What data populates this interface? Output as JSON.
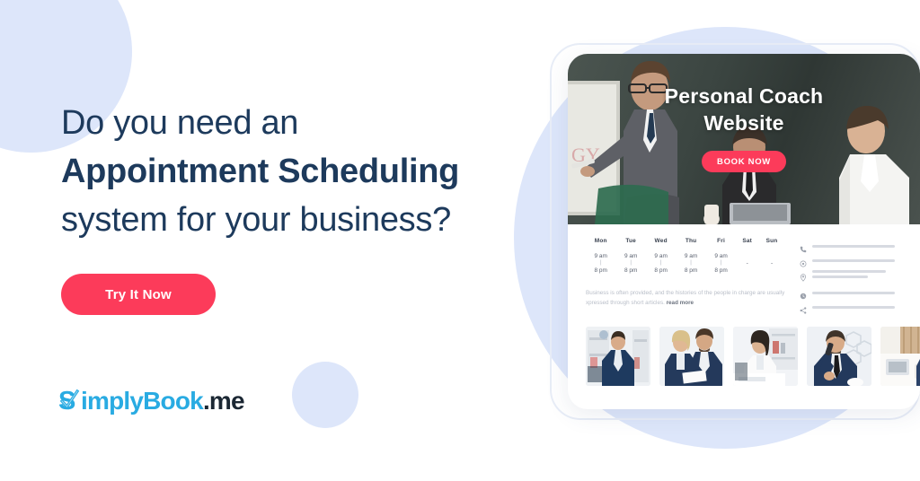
{
  "colors": {
    "headline": "#1d3a5c",
    "accent_pink": "#fc3b5a",
    "logo_blue": "#29ABE2",
    "logo_dark": "#1b2733",
    "blob_blue": "#dde6fa"
  },
  "hero": {
    "headline_line1": "Do you need an",
    "headline_line2": "Appointment Scheduling",
    "headline_line3": "system for your business?",
    "cta_label": "Try It Now"
  },
  "logo": {
    "name_part1": "S",
    "name_part2": "implyBook",
    "name_part3": ".me",
    "mark_icon": "checkmark-s-icon"
  },
  "mockup": {
    "hero": {
      "title_line1": "Personal Coach",
      "title_line2": "Website",
      "book_button": "BOOK NOW"
    },
    "schedule": {
      "days": [
        "Mon",
        "Tue",
        "Wed",
        "Thu",
        "Fri",
        "Sat",
        "Sun"
      ],
      "open": [
        "9 am",
        "9 am",
        "9 am",
        "9 am",
        "9 am",
        "-",
        "-"
      ],
      "separator": "|",
      "close": [
        "8 pm",
        "8 pm",
        "8 pm",
        "8 pm",
        "8 pm",
        "",
        ""
      ]
    },
    "blurb": {
      "text": "Business is often provided, and the histories of the people in charge are usually xpressed through short articles.",
      "link": "read more"
    },
    "contacts": [
      {
        "icon": "phone-icon",
        "bars": [
          1
        ]
      },
      {
        "icon": "globe-icon",
        "bars": [
          1
        ]
      },
      {
        "icon": "location-pin-icon",
        "bars": [
          2
        ]
      },
      {
        "icon": "clock-icon",
        "bars": [
          1
        ]
      },
      {
        "icon": "share-icon",
        "bars": [
          1
        ]
      }
    ],
    "thumbnails": [
      {
        "alt": "businessman-standing-in-office"
      },
      {
        "alt": "two-colleagues-reviewing-documents"
      },
      {
        "alt": "businesswoman-working-at-desk"
      },
      {
        "alt": "businessman-on-phone-taking-notes"
      },
      {
        "alt": "person-at-desk-with-notebook"
      }
    ]
  }
}
